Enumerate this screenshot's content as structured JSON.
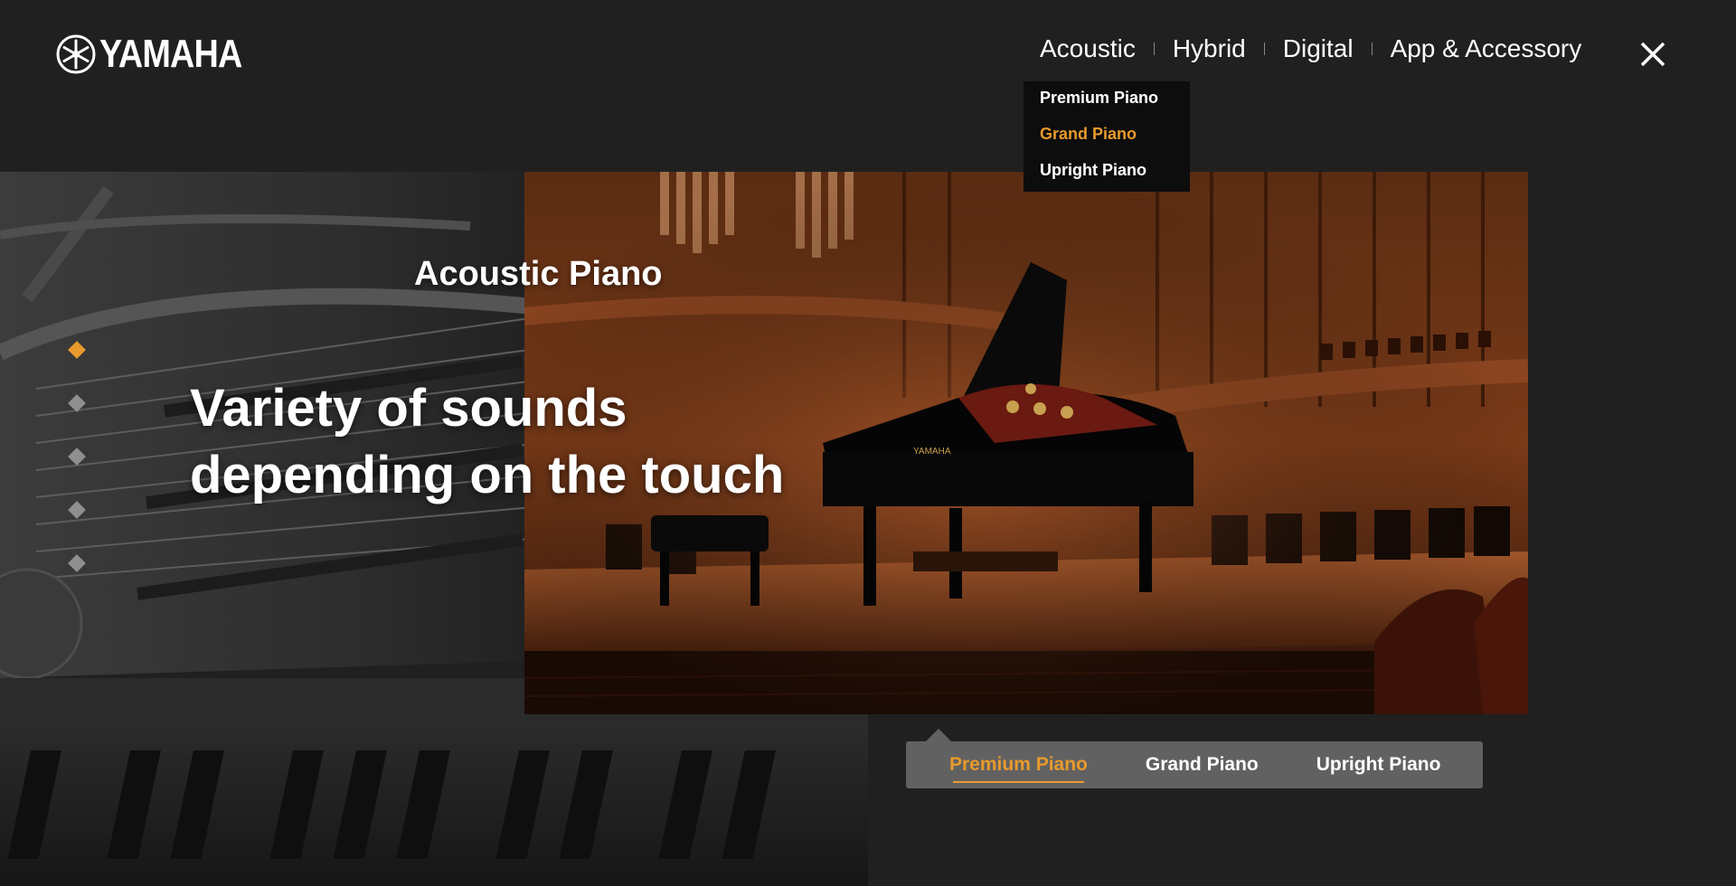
{
  "brand": {
    "name": "YAMAHA",
    "icon": "yamaha-tuning-forks-icon"
  },
  "nav": {
    "items": [
      "Acoustic",
      "Hybrid",
      "Digital",
      "App & Accessory"
    ],
    "close_icon": "close-icon"
  },
  "dropdown": {
    "items": [
      "Premium Piano",
      "Grand Piano",
      "Upright Piano"
    ],
    "active_index": 1
  },
  "hero": {
    "section_label": "Acoustic Piano",
    "headline_line1": "Variety of sounds",
    "headline_line2": "depending on the touch",
    "slide_count": 5,
    "active_slide": 0
  },
  "tabs": {
    "items": [
      "Premium Piano",
      "Grand Piano",
      "Upright Piano"
    ],
    "active_index": 0
  },
  "colors": {
    "background": "#202020",
    "accent": "#e89a2c",
    "dropdown_bg": "#0d0d0d",
    "tabbar_bg": "#616161"
  }
}
